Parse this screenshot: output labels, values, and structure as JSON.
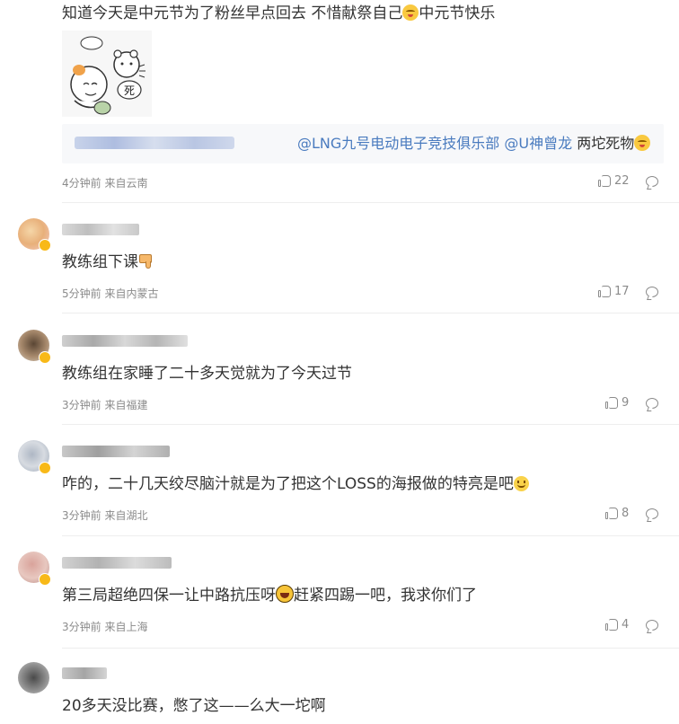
{
  "comments": [
    {
      "text": "知道今天是中元节为了粉丝早点回去 不惜献祭自己",
      "text_tail": "中元节快乐",
      "reply_prefix": "",
      "reply_mention1": "@LNG九号电动电子竞技俱乐部",
      "reply_mention2": "@U神曾龙",
      "reply_suffix": "两坨死物",
      "sticker_text": "死",
      "meta": "4分钟前 来自云南",
      "likes": "22"
    },
    {
      "text": "教练组下课",
      "meta": "5分钟前 来自内蒙古",
      "likes": "17"
    },
    {
      "text": "教练组在家睡了二十多天觉就为了今天过节",
      "meta": "3分钟前 来自福建",
      "likes": "9"
    },
    {
      "text": "咋的，二十几天绞尽脑汁就是为了把这个LOSS的海报做的特亮是吧",
      "meta": "3分钟前 来自湖北",
      "likes": "8"
    },
    {
      "text": "第三局超绝四保一让中路抗压呀",
      "text_tail": "赶紧四踢一吧，我求你们了",
      "meta": "3分钟前 来自上海",
      "likes": "4"
    },
    {
      "text": "20多天没比赛，憋了这——么大一坨啊"
    }
  ],
  "colors": {
    "mention": "#4a7bbf",
    "meta": "#8b8b8b",
    "verified": "#f8b918"
  },
  "icons": [
    "like-icon",
    "reply-icon",
    "emoji-icon",
    "thumbs-down-icon"
  ]
}
